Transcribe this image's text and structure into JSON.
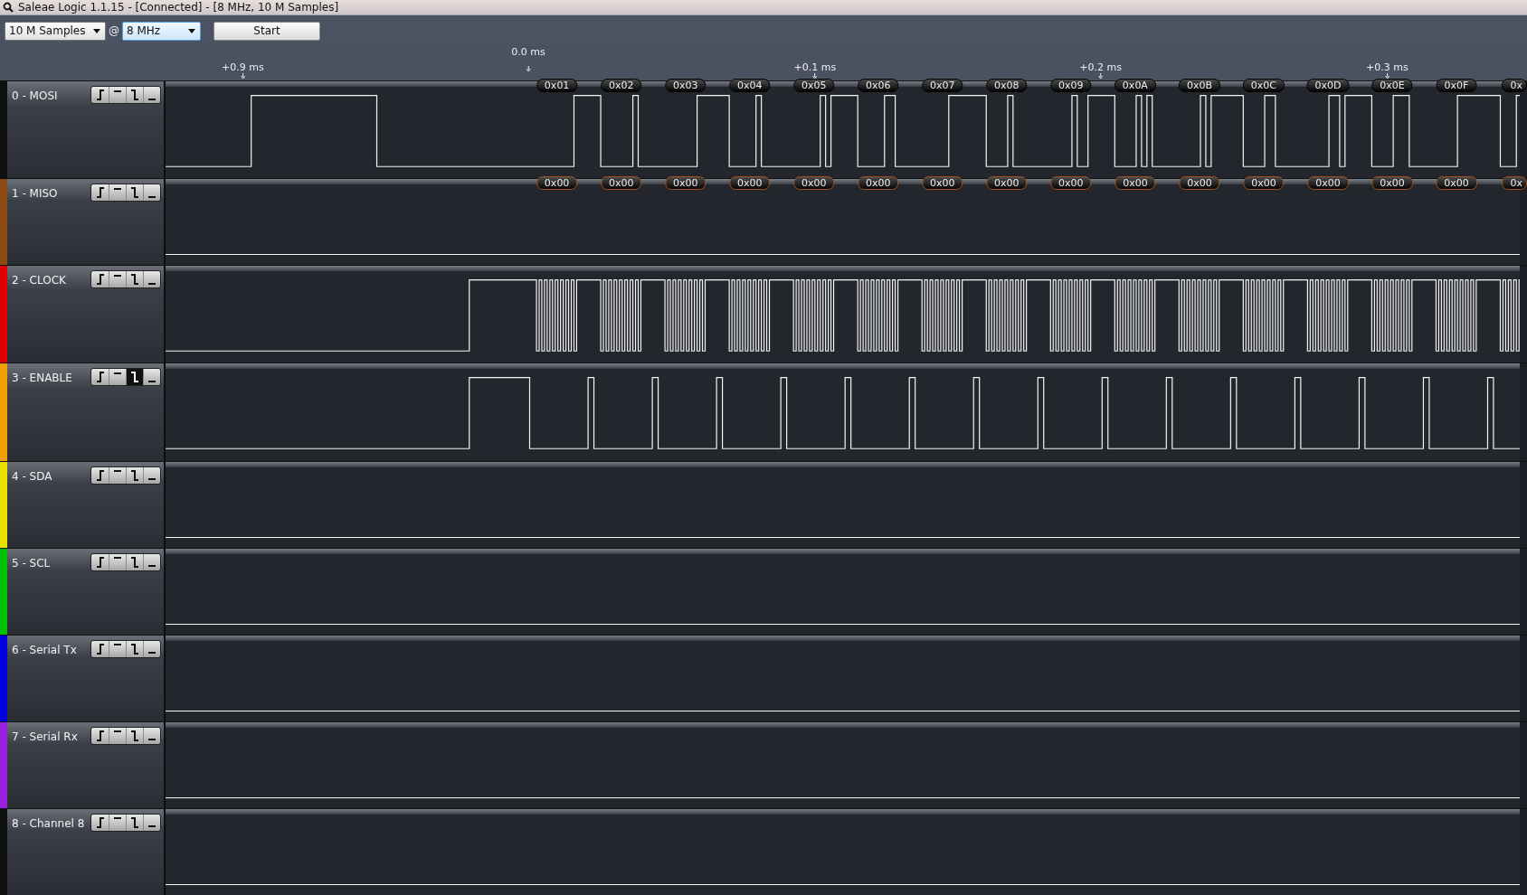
{
  "window": {
    "title": "Saleae Logic 1.1.15 - [Connected] - [8 MHz, 10 M Samples]"
  },
  "toolbar": {
    "sample_count": "10 M Samples",
    "at_sign": "@",
    "sample_rate": "8 MHz",
    "start_button": "Start"
  },
  "ruler": {
    "markers": [
      {
        "label": "+0.9 ms",
        "kind": "offset"
      },
      {
        "label": "0.0 ms",
        "kind": "trigger"
      },
      {
        "label": "+0.1 ms",
        "kind": "offset"
      },
      {
        "label": "+0.2 ms",
        "kind": "offset"
      },
      {
        "label": "+0.3 ms",
        "kind": "offset"
      }
    ]
  },
  "channels": [
    {
      "name": "0 - MOSI",
      "color": "#101010",
      "triggers": [
        {
          "kind": "rising",
          "selected": false
        },
        {
          "kind": "high",
          "selected": false
        },
        {
          "kind": "falling",
          "selected": false
        },
        {
          "kind": "low",
          "selected": false
        }
      ],
      "decoded": [
        "0x01",
        "0x02",
        "0x03",
        "0x04",
        "0x05",
        "0x06",
        "0x07",
        "0x08",
        "0x09",
        "0x0A",
        "0x0B",
        "0x0C",
        "0x0D",
        "0x0E",
        "0x0F",
        "0x"
      ]
    },
    {
      "name": "1 - MISO",
      "color": "#8a4a12",
      "triggers": [
        {
          "kind": "rising",
          "selected": false
        },
        {
          "kind": "high",
          "selected": false
        },
        {
          "kind": "falling",
          "selected": false
        },
        {
          "kind": "low",
          "selected": false
        }
      ],
      "decoded": [
        "0x00",
        "0x00",
        "0x00",
        "0x00",
        "0x00",
        "0x00",
        "0x00",
        "0x00",
        "0x00",
        "0x00",
        "0x00",
        "0x00",
        "0x00",
        "0x00",
        "0x00",
        "0x"
      ]
    },
    {
      "name": "2 - CLOCK",
      "color": "#e00000",
      "triggers": [
        {
          "kind": "rising",
          "selected": false
        },
        {
          "kind": "high",
          "selected": false
        },
        {
          "kind": "falling",
          "selected": false
        },
        {
          "kind": "low",
          "selected": false
        }
      ]
    },
    {
      "name": "3 - ENABLE",
      "color": "#f0a000",
      "triggers": [
        {
          "kind": "rising",
          "selected": false
        },
        {
          "kind": "high",
          "selected": false
        },
        {
          "kind": "falling",
          "selected": true
        },
        {
          "kind": "low",
          "selected": false
        }
      ]
    },
    {
      "name": "4 - SDA",
      "color": "#e8e000",
      "triggers": [
        {
          "kind": "rising",
          "selected": false
        },
        {
          "kind": "high",
          "selected": false
        },
        {
          "kind": "falling",
          "selected": false
        },
        {
          "kind": "low",
          "selected": false
        }
      ]
    },
    {
      "name": "5 - SCL",
      "color": "#00c000",
      "triggers": [
        {
          "kind": "rising",
          "selected": false
        },
        {
          "kind": "high",
          "selected": false
        },
        {
          "kind": "falling",
          "selected": false
        },
        {
          "kind": "low",
          "selected": false
        }
      ]
    },
    {
      "name": "6 - Serial Tx",
      "color": "#0000e0",
      "triggers": [
        {
          "kind": "rising",
          "selected": false
        },
        {
          "kind": "high",
          "selected": false
        },
        {
          "kind": "falling",
          "selected": false
        },
        {
          "kind": "low",
          "selected": false
        }
      ]
    },
    {
      "name": "7 - Serial Rx",
      "color": "#9a20e0",
      "triggers": [
        {
          "kind": "rising",
          "selected": false
        },
        {
          "kind": "high",
          "selected": false
        },
        {
          "kind": "falling",
          "selected": false
        },
        {
          "kind": "low",
          "selected": false
        }
      ]
    },
    {
      "name": "8 - Channel 8",
      "color": "#101010",
      "triggers": [
        {
          "kind": "rising",
          "selected": false
        },
        {
          "kind": "high",
          "selected": false
        },
        {
          "kind": "falling",
          "selected": false
        },
        {
          "kind": "low",
          "selected": false
        }
      ]
    }
  ]
}
